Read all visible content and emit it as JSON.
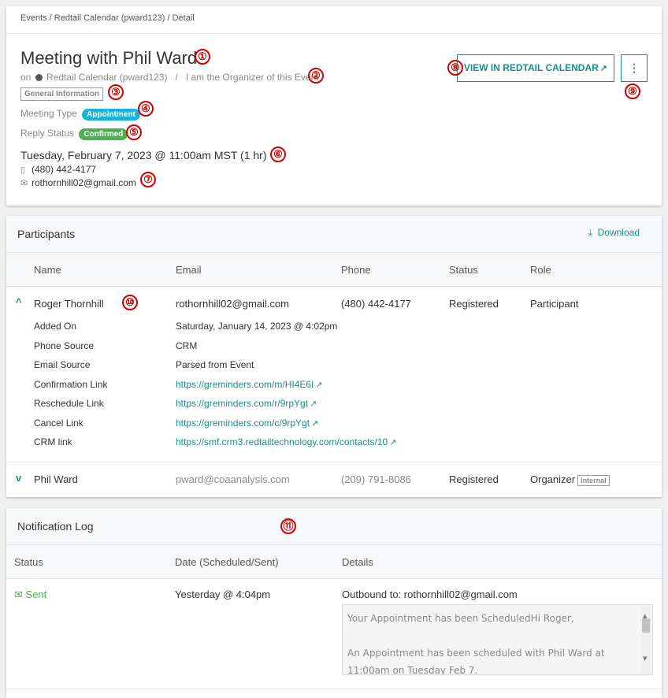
{
  "breadcrumb": "Events / Redtail Calendar (pward123) / Detail",
  "event": {
    "title": "Meeting with Phil Ward",
    "calendar_prefix": "on",
    "calendar_name": "Redtail Calendar (pward123)",
    "separator": "/",
    "organizer_note": "I am the Organizer of this Event",
    "general_info_label": "General Information",
    "meeting_type_label": "Meeting Type",
    "meeting_type_value": "Appointment",
    "meeting_type_color": "#1ab4d8",
    "reply_status_label": "Reply Status",
    "reply_status_value": "Confirmed",
    "reply_status_color": "#4caf50",
    "datetime": "Tuesday, February 7, 2023 @ 11:00am MST (1 hr)",
    "phone": "(480) 442-4177",
    "email": "rothornhill02@gmail.com",
    "view_button": "VIEW IN REDTAIL CALENDAR",
    "more_button": "⋮"
  },
  "participants": {
    "title": "Participants",
    "download_label": "Download",
    "columns": [
      "Name",
      "Email",
      "Phone",
      "Status",
      "Role"
    ],
    "rows": [
      {
        "name": "Roger Thornhill",
        "email": "rothornhill02@gmail.com",
        "phone": "(480) 442-4177",
        "status": "Registered",
        "role": "Participant",
        "expanded": true,
        "details": [
          {
            "label": "Added On",
            "value": "Saturday, January 14, 2023 @ 4:02pm"
          },
          {
            "label": "Phone Source",
            "value": "CRM"
          },
          {
            "label": "Email Source",
            "value": "Parsed from Event"
          },
          {
            "label": "Confirmation Link",
            "value": "https://greminders.com/m/HI4E6I"
          },
          {
            "label": "Reschedule Link",
            "value": "https://greminders.com/r/9rpYgt"
          },
          {
            "label": "Cancel Link",
            "value": "https://greminders.com/c/9rpYgt"
          },
          {
            "label": "CRM link",
            "value": "https://smf.crm3.redtailtechnology.com/contacts/10"
          }
        ]
      },
      {
        "name": "Phil Ward",
        "email": "pward@coaanalysis.com",
        "phone": "(209) 791-8086",
        "status": "Registered",
        "role": "Organizer",
        "role_badge": "Internal",
        "expanded": false
      }
    ]
  },
  "notification_log": {
    "title": "Notification Log",
    "columns": [
      "Status",
      "Date (Scheduled/Sent)",
      "Details"
    ],
    "rows": [
      {
        "status": "Sent",
        "date": "Yesterday @ 4:04pm",
        "outbound": "Outbound to: rothornhill02@gmail.com",
        "message": "Your Appointment has been ScheduledHi Roger,\n\nAn Appointment has been scheduled with Phil Ward at 11:00am on Tuesday Feb 7."
      }
    ]
  },
  "annotations": [
    "①",
    "②",
    "③",
    "④",
    "⑤",
    "⑥",
    "⑦",
    "⑧",
    "⑨",
    "⑩",
    "⑪"
  ],
  "colors": {
    "accent": "#1a8f81",
    "sent": "#4caf50",
    "annotation": "#d40000"
  }
}
